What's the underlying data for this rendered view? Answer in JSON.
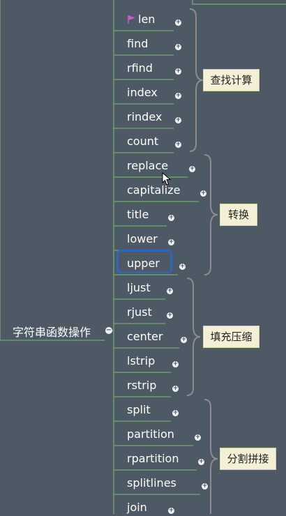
{
  "root_label": "字符串函数操作",
  "collapse_symbol": "−",
  "expand_symbol": "+",
  "items": [
    {
      "label": "len",
      "flagged": true
    },
    {
      "label": "find"
    },
    {
      "label": "rfind"
    },
    {
      "label": "index"
    },
    {
      "label": "rindex"
    },
    {
      "label": "count"
    },
    {
      "label": "replace"
    },
    {
      "label": "capitalize"
    },
    {
      "label": "title"
    },
    {
      "label": "lower"
    },
    {
      "label": "upper",
      "selected": true
    },
    {
      "label": "ljust"
    },
    {
      "label": "rjust"
    },
    {
      "label": "center"
    },
    {
      "label": "lstrip"
    },
    {
      "label": "rstrip"
    },
    {
      "label": "split"
    },
    {
      "label": "partition"
    },
    {
      "label": "rpartition"
    },
    {
      "label": "splitlines"
    },
    {
      "label": "join"
    }
  ],
  "groups": [
    {
      "label": "查找计算"
    },
    {
      "label": "转换"
    },
    {
      "label": "填充压缩"
    },
    {
      "label": "分割拼接"
    }
  ],
  "colors": {
    "background": "#4d5a66",
    "branch_line": "#6aa06a",
    "brace": "#8c8c8c",
    "selection": "#2f67b8",
    "label_bg": "#f4f0d6",
    "flag": "#c65bd0"
  }
}
